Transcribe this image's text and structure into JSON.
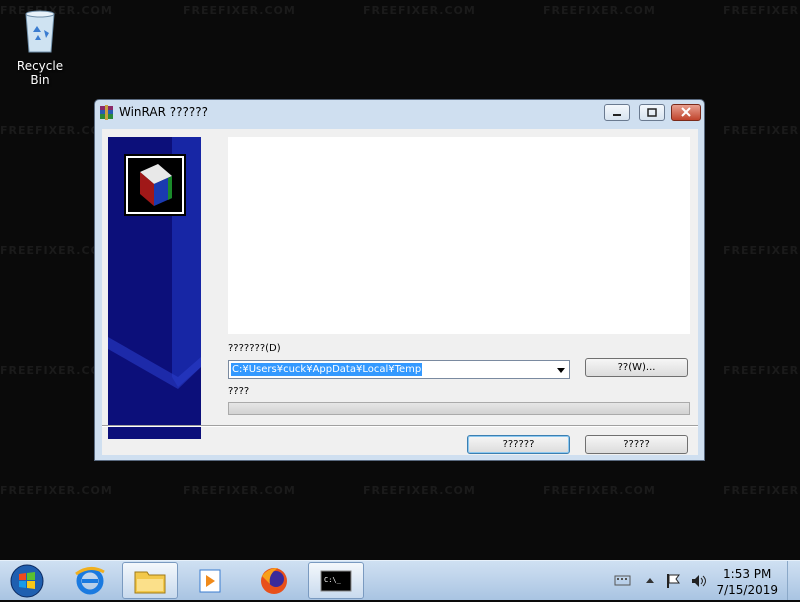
{
  "desktop": {
    "recycle_bin_label": "Recycle Bin",
    "watermark": "FREEFIXER.COM"
  },
  "window": {
    "title": "WinRAR ??????",
    "icon": "winrar-icon",
    "controls": [
      "minimize-icon",
      "maximize-icon",
      "close-icon"
    ],
    "destination_label": "???????(D)",
    "destination_value": "C:¥Users¥cuck¥AppData¥Local¥Temp",
    "browse_label": "??(W)...",
    "progress_label": "????",
    "install_label": "??????",
    "cancel_label": "?????"
  },
  "taskbar": {
    "items": [
      "start-orb",
      "internet-explorer-icon",
      "file-explorer-icon",
      "media-player-icon",
      "firefox-icon",
      "command-prompt-icon"
    ],
    "time": "1:53 PM",
    "date": "7/15/2019"
  },
  "colors": {
    "sidebar": "#0c0f7a",
    "selection": "#3399ff",
    "taskbar": "#bcd3ec"
  }
}
